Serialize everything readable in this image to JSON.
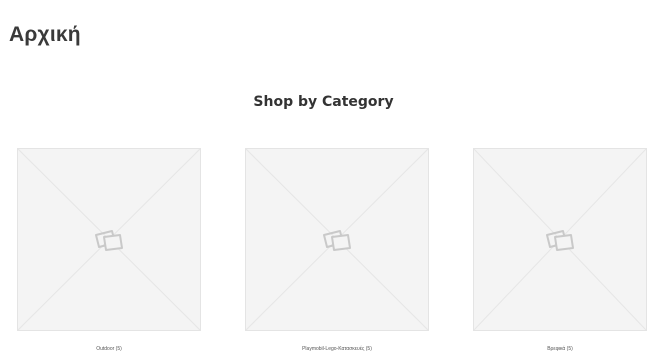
{
  "page": {
    "title": "Αρχική"
  },
  "section": {
    "heading": "Shop by Category"
  },
  "categories": [
    {
      "name": "Outdoor",
      "count": "(5)"
    },
    {
      "name": "Playmobil-Lego-Κατασκευές",
      "count": "(5)"
    },
    {
      "name": "Βρεφικά",
      "count": "(5)"
    }
  ],
  "icons": {
    "placeholder": "image-placeholder-icon"
  }
}
